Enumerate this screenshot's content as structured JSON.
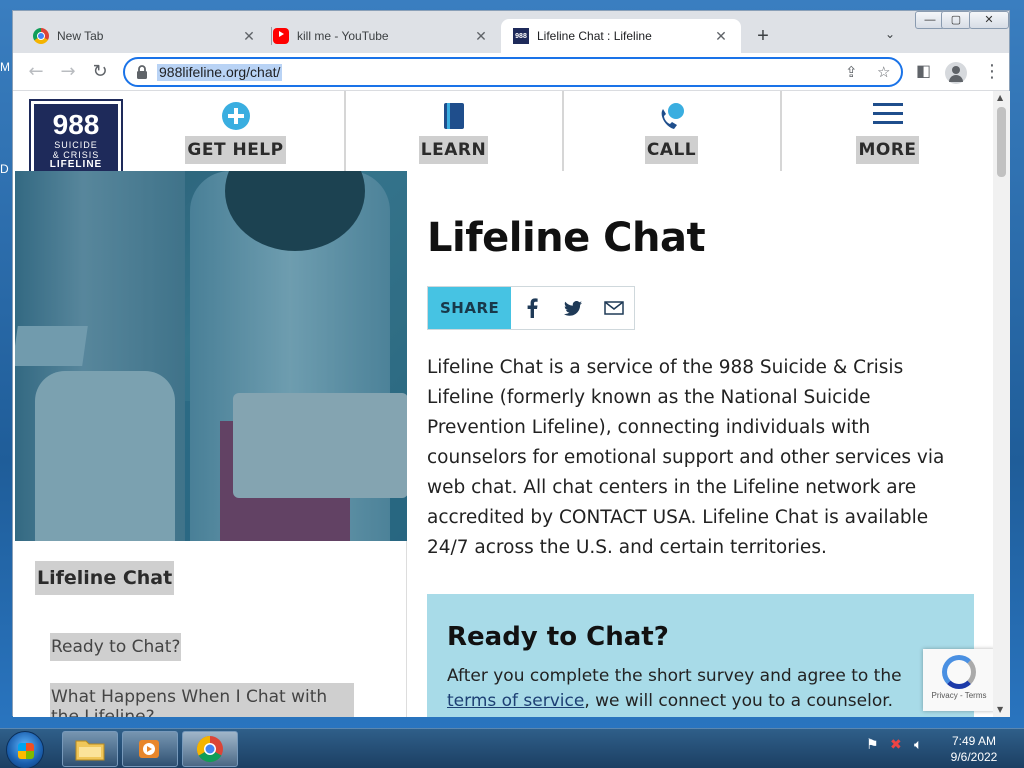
{
  "desktop": {
    "left_text_1": "M",
    "left_text_2": "D"
  },
  "tabs": [
    {
      "title": "New Tab",
      "close": "✕"
    },
    {
      "title": "kill me - YouTube",
      "close": "✕"
    },
    {
      "title": "Lifeline Chat : Lifeline",
      "close": "✕",
      "favicon_text": "988"
    }
  ],
  "tabstrip": {
    "new_tab": "+",
    "tab_list": "⌄"
  },
  "window_controls": {
    "minimize": "—",
    "maximize": "▢",
    "close": "✕"
  },
  "toolbar": {
    "back": "←",
    "forward": "→",
    "reload": "↻",
    "url": "988lifeline.org/chat/",
    "share": "⇪",
    "bookmark": "☆",
    "sidepanel": "◧",
    "menu": "⋮"
  },
  "site": {
    "logo": {
      "number": "988",
      "line1": "SUICIDE",
      "line2": "& CRISIS",
      "line3": "LIFELINE"
    },
    "nav": [
      {
        "label": "GET HELP",
        "icon": "plus-circle-icon"
      },
      {
        "label": "LEARN",
        "icon": "book-icon"
      },
      {
        "label": "CALL",
        "icon": "phone-chat-icon"
      },
      {
        "label": "MORE",
        "icon": "hamburger-menu-icon"
      }
    ],
    "title": "Lifeline Chat",
    "share_label": "SHARE",
    "intro": "Lifeline Chat is a service of the 988 Suicide & Crisis Lifeline (formerly known as the National Suicide Prevention Lifeline), connecting individuals with counselors for emotional support and other services via web chat. All chat centers in the Lifeline network are accredited by CONTACT USA. Lifeline Chat is available 24/7 across the U.S. and certain territories.",
    "sidenav": {
      "title": "Lifeline Chat",
      "items": [
        "Ready to Chat?",
        "What Happens When I Chat with the Lifeline?"
      ]
    },
    "ready": {
      "heading": "Ready to Chat?",
      "text_before": "After you complete the short survey and agree to the ",
      "link": "terms of service",
      "text_after": ", we will connect you to a counselor."
    },
    "recaptcha": {
      "links": "Privacy - Terms"
    }
  },
  "taskbar": {
    "time": "7:49 AM",
    "date": "9/6/2022"
  },
  "colors": {
    "accent": "#1a73e8",
    "brand_navy": "#1e2a5a",
    "share_blue": "#46c3e3",
    "ready_bg": "#a8dbe8"
  }
}
